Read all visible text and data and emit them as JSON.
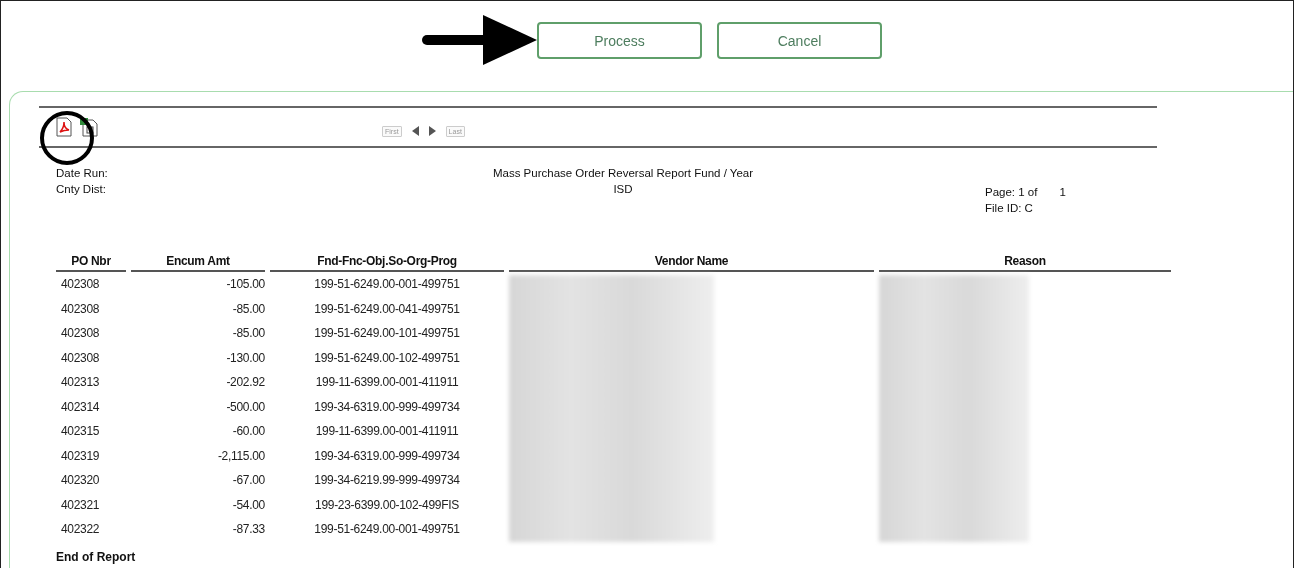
{
  "buttons": [
    {
      "label": "Process"
    },
    {
      "label": "Cancel"
    }
  ],
  "report_toolbar": {
    "first": "First",
    "last": "Last"
  },
  "report_header": {
    "date_run_label": "Date Run:",
    "cnty_dist_label": "Cnty Dist:",
    "title": "Mass Purchase Order Reversal Report Fund / Year",
    "subtitle": "ISD",
    "page_label": "Page: 1  of",
    "page_total": "1",
    "file_id": "File ID: C"
  },
  "table": {
    "columns": [
      "PO Nbr",
      "Encum Amt",
      "Fnd-Fnc-Obj.So-Org-Prog",
      "Vendor Name",
      "Reason"
    ],
    "rows": [
      {
        "po": "402308",
        "amount": "-105.00",
        "account": "199-51-6249.00-001-499751"
      },
      {
        "po": "402308",
        "amount": "-85.00",
        "account": "199-51-6249.00-041-499751"
      },
      {
        "po": "402308",
        "amount": "-85.00",
        "account": "199-51-6249.00-101-499751"
      },
      {
        "po": "402308",
        "amount": "-130.00",
        "account": "199-51-6249.00-102-499751"
      },
      {
        "po": "402313",
        "amount": "-202.92",
        "account": "199-11-6399.00-001-411911"
      },
      {
        "po": "402314",
        "amount": "-500.00",
        "account": "199-34-6319.00-999-499734"
      },
      {
        "po": "402315",
        "amount": "-60.00",
        "account": "199-11-6399.00-001-411911"
      },
      {
        "po": "402319",
        "amount": "-2,115.00",
        "account": "199-34-6319.00-999-499734"
      },
      {
        "po": "402320",
        "amount": "-67.00",
        "account": "199-34-6219.99-999-499734"
      },
      {
        "po": "402321",
        "amount": "-54.00",
        "account": "199-23-6399.00-102-499FIS"
      },
      {
        "po": "402322",
        "amount": "-87.33",
        "account": "199-51-6249.00-001-499751"
      }
    ]
  },
  "footer": "End of Report"
}
